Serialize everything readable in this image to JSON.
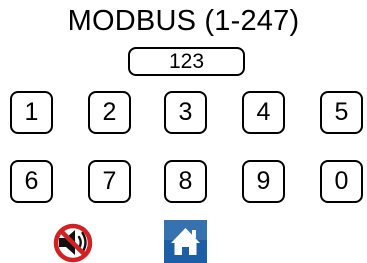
{
  "title": "MODBUS (1-247)",
  "display": {
    "value": "123"
  },
  "keypad": {
    "keys": [
      "1",
      "2",
      "3",
      "4",
      "5",
      "6",
      "7",
      "8",
      "9",
      "0"
    ]
  },
  "bottom_bar": {
    "mute_icon": "speaker-muted-icon",
    "home_icon": "home-icon"
  },
  "colors": {
    "mute_ring": "#d42020",
    "home_tile": "#1c5fa6"
  }
}
